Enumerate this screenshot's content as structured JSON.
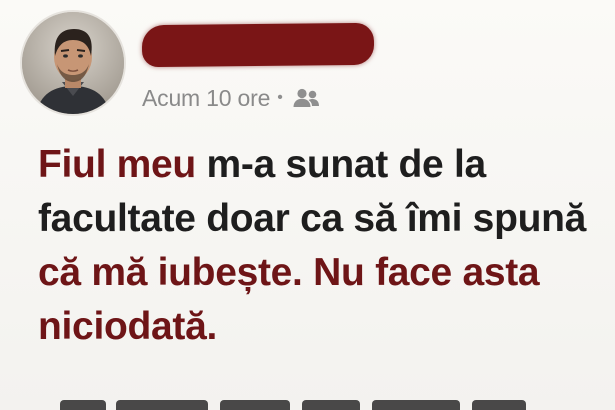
{
  "post": {
    "author_redacted": true,
    "timestamp": "Acum 10 ore",
    "separator": "•",
    "audience_icon": "friends-icon",
    "body_lines": [
      [
        {
          "text": "Fiul meu",
          "style": "hl"
        },
        {
          "text": " m-a sunat de la",
          "style": "plain"
        }
      ],
      [
        {
          "text": "facultate doar ca să îmi spună",
          "style": "plain"
        }
      ],
      [
        {
          "text": "că mă iubește. ",
          "style": "hl"
        },
        {
          "text": "Nu face asta",
          "style": "hl"
        }
      ],
      [
        {
          "text": "niciodată.",
          "style": "hl"
        }
      ]
    ]
  },
  "colors": {
    "highlight": "#6e1517",
    "redaction": "#7a1516",
    "body_text": "#1e1e1e",
    "meta_text": "#8a8a8a"
  }
}
